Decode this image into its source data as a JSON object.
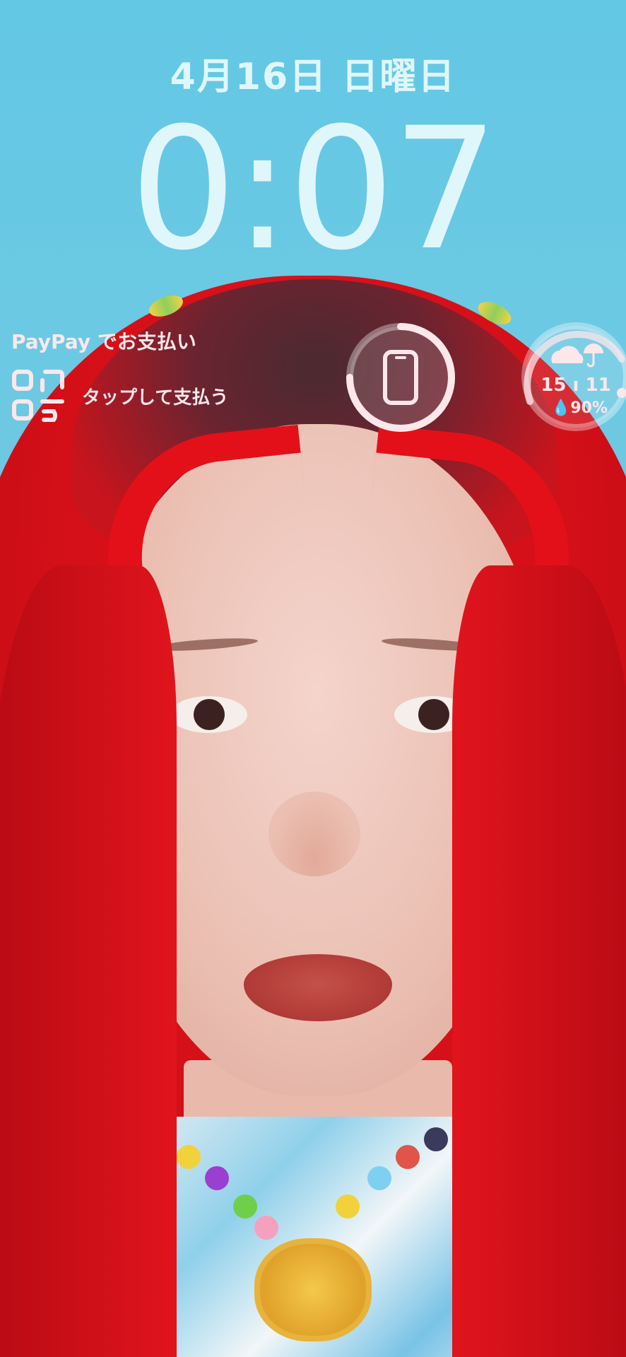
{
  "lockscreen": {
    "date": "4月16日 日曜日",
    "time": "0:07"
  },
  "widgets": {
    "paypay": {
      "title": "PayPay でお支払い",
      "action": "タップして支払う",
      "icon": "qr-code-icon"
    },
    "battery": {
      "icon": "phone-icon",
      "level_fraction": 0.75
    },
    "weather": {
      "icon": "cloud-umbrella-icon",
      "temps": "15 ı 11",
      "rain": "90%"
    }
  },
  "colors": {
    "sky": "#62c8e4",
    "text": "#dff6fb",
    "widget_text": "#fde7ea",
    "hair": "#e0131b"
  }
}
